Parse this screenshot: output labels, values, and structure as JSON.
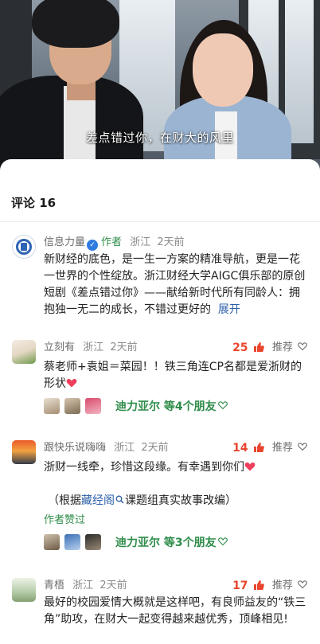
{
  "video": {
    "subtitle": "差点错过你，在财大的风里"
  },
  "comments_header": {
    "title": "评论 16"
  },
  "pinned_post": {
    "author": "信息力量",
    "tag": "作者",
    "location": "浙江",
    "time": "2天前",
    "body": "新财经的底色，是一生一方案的精准导航，更是一花一世界的个性绽放。浙江财经大学AIGC俱乐部的原创短剧《差点错过你》——献给新时代所有同龄人：拥抱独一无二的成长，不错过更好的",
    "expand_label": "展开"
  },
  "comments": [
    {
      "author": "立刻有",
      "location": "浙江",
      "time": "2天前",
      "likes": "25",
      "recommend_label": "推荐",
      "body": "蔡老师+袁姐＝菜园！！铁三角连CP名都是爱浙财的形状",
      "friends_text": "迪力亚尔 等4个朋友"
    },
    {
      "author": "跟快乐说嗨嗨",
      "location": "浙江",
      "time": "2天前",
      "likes": "14",
      "recommend_label": "推荐",
      "body": "浙财一线牵，珍惜这段缘。有幸遇到你们",
      "note_prefix": "（根据",
      "note_link": "藏经阁",
      "note_suffix": "课题组真实故事改编）",
      "author_liked": "作者赞过",
      "friends_text": "迪力亚尔 等3个朋友"
    },
    {
      "author": "青梧",
      "location": "浙江",
      "time": "2天前",
      "likes": "17",
      "recommend_label": "推荐",
      "body": "最好的校园爱情大概就是这样吧，有良师益友的“铁三角”助攻，在财大一起变得越来越优秀，顶峰相见!"
    }
  ],
  "colors": {
    "like_red": "#e9452f",
    "author_green": "#2e8c4a",
    "link_blue": "#2b5fa8"
  },
  "icons": [
    "verified-icon",
    "thumbs-up-icon",
    "heart-outline-icon",
    "red-heart-icon",
    "search-icon"
  ]
}
